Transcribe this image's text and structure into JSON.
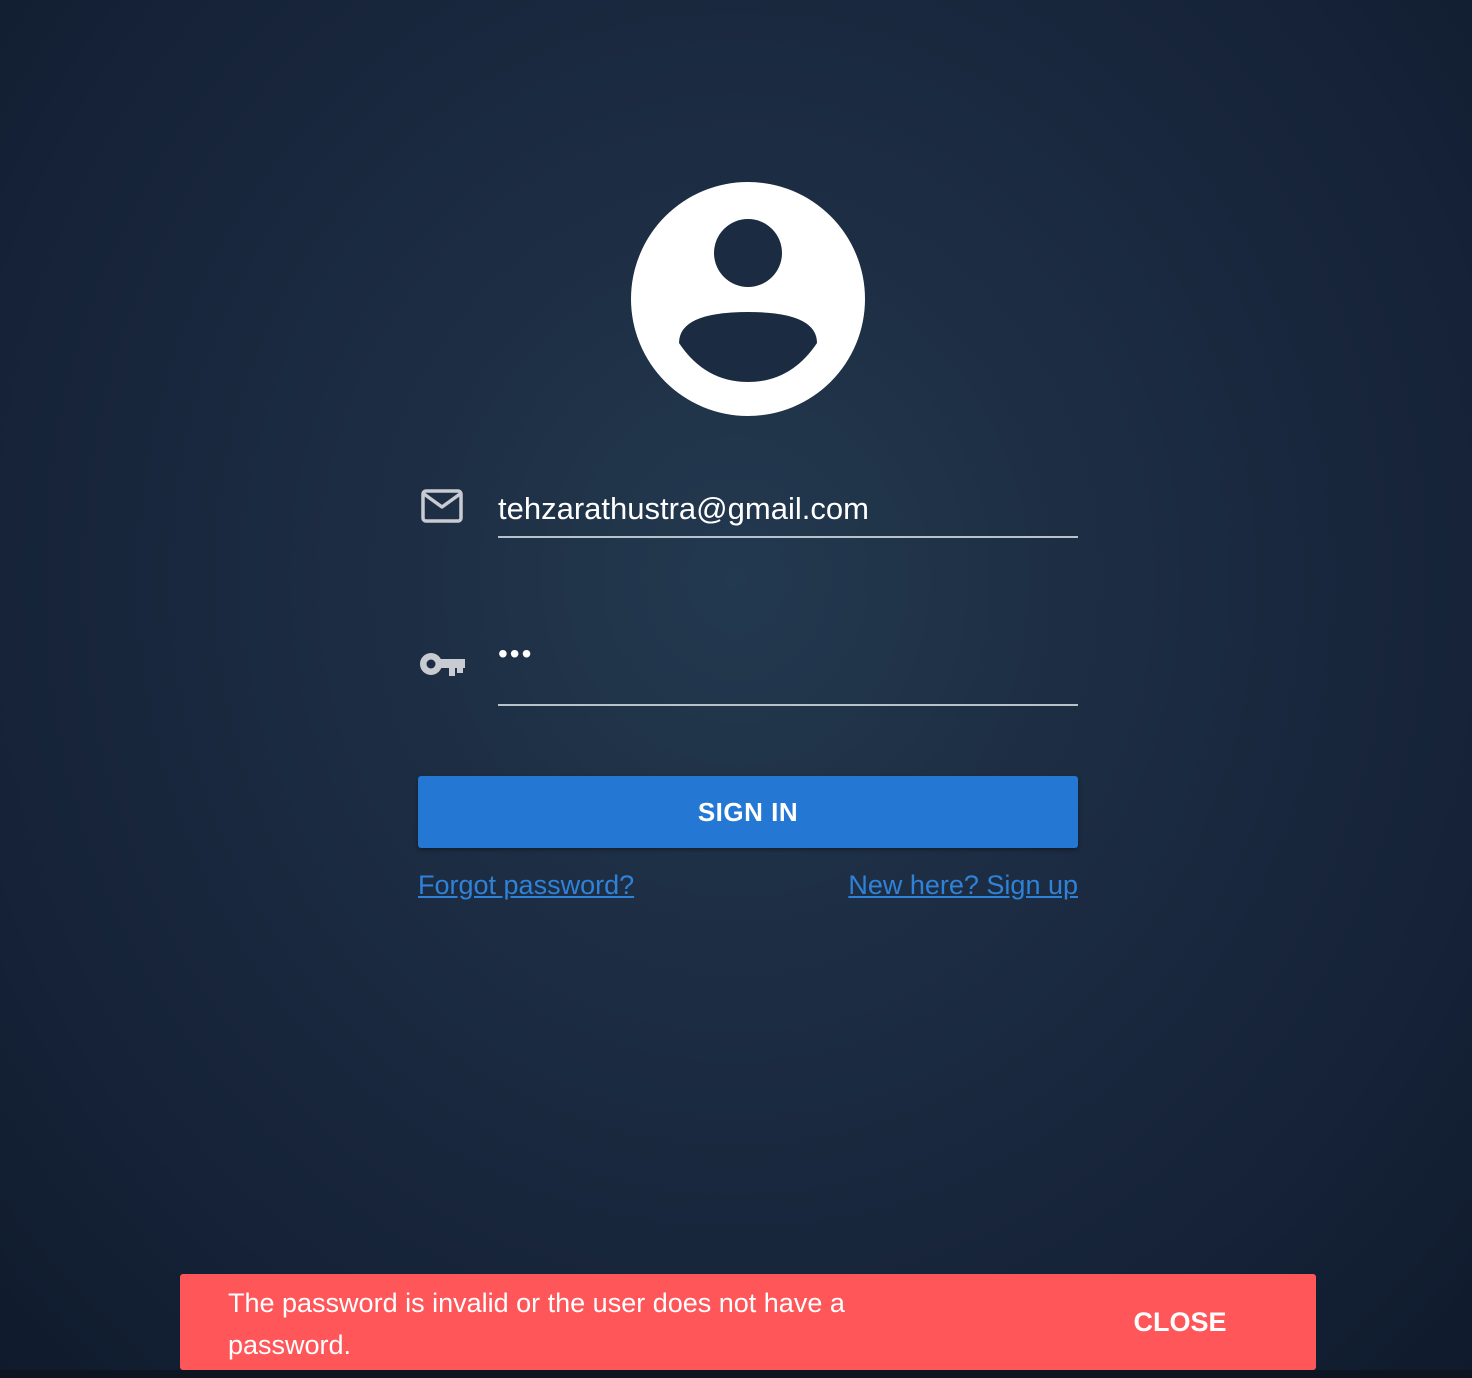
{
  "login": {
    "avatar_icon": "account-circle-icon",
    "email": {
      "icon": "mail-icon",
      "value": "tehzarathustra@gmail.com"
    },
    "password": {
      "icon": "key-icon",
      "value": "•••"
    },
    "sign_in_label": "SIGN IN",
    "forgot_password_label": "Forgot password?",
    "sign_up_label": "New here? Sign up"
  },
  "snackbar": {
    "message": "The password is invalid or the user does not have a password.",
    "close_label": "CLOSE",
    "color": "#fe5659"
  },
  "colors": {
    "primary": "#2477d2",
    "link": "#2f82d8",
    "background": "#1c2c42"
  }
}
